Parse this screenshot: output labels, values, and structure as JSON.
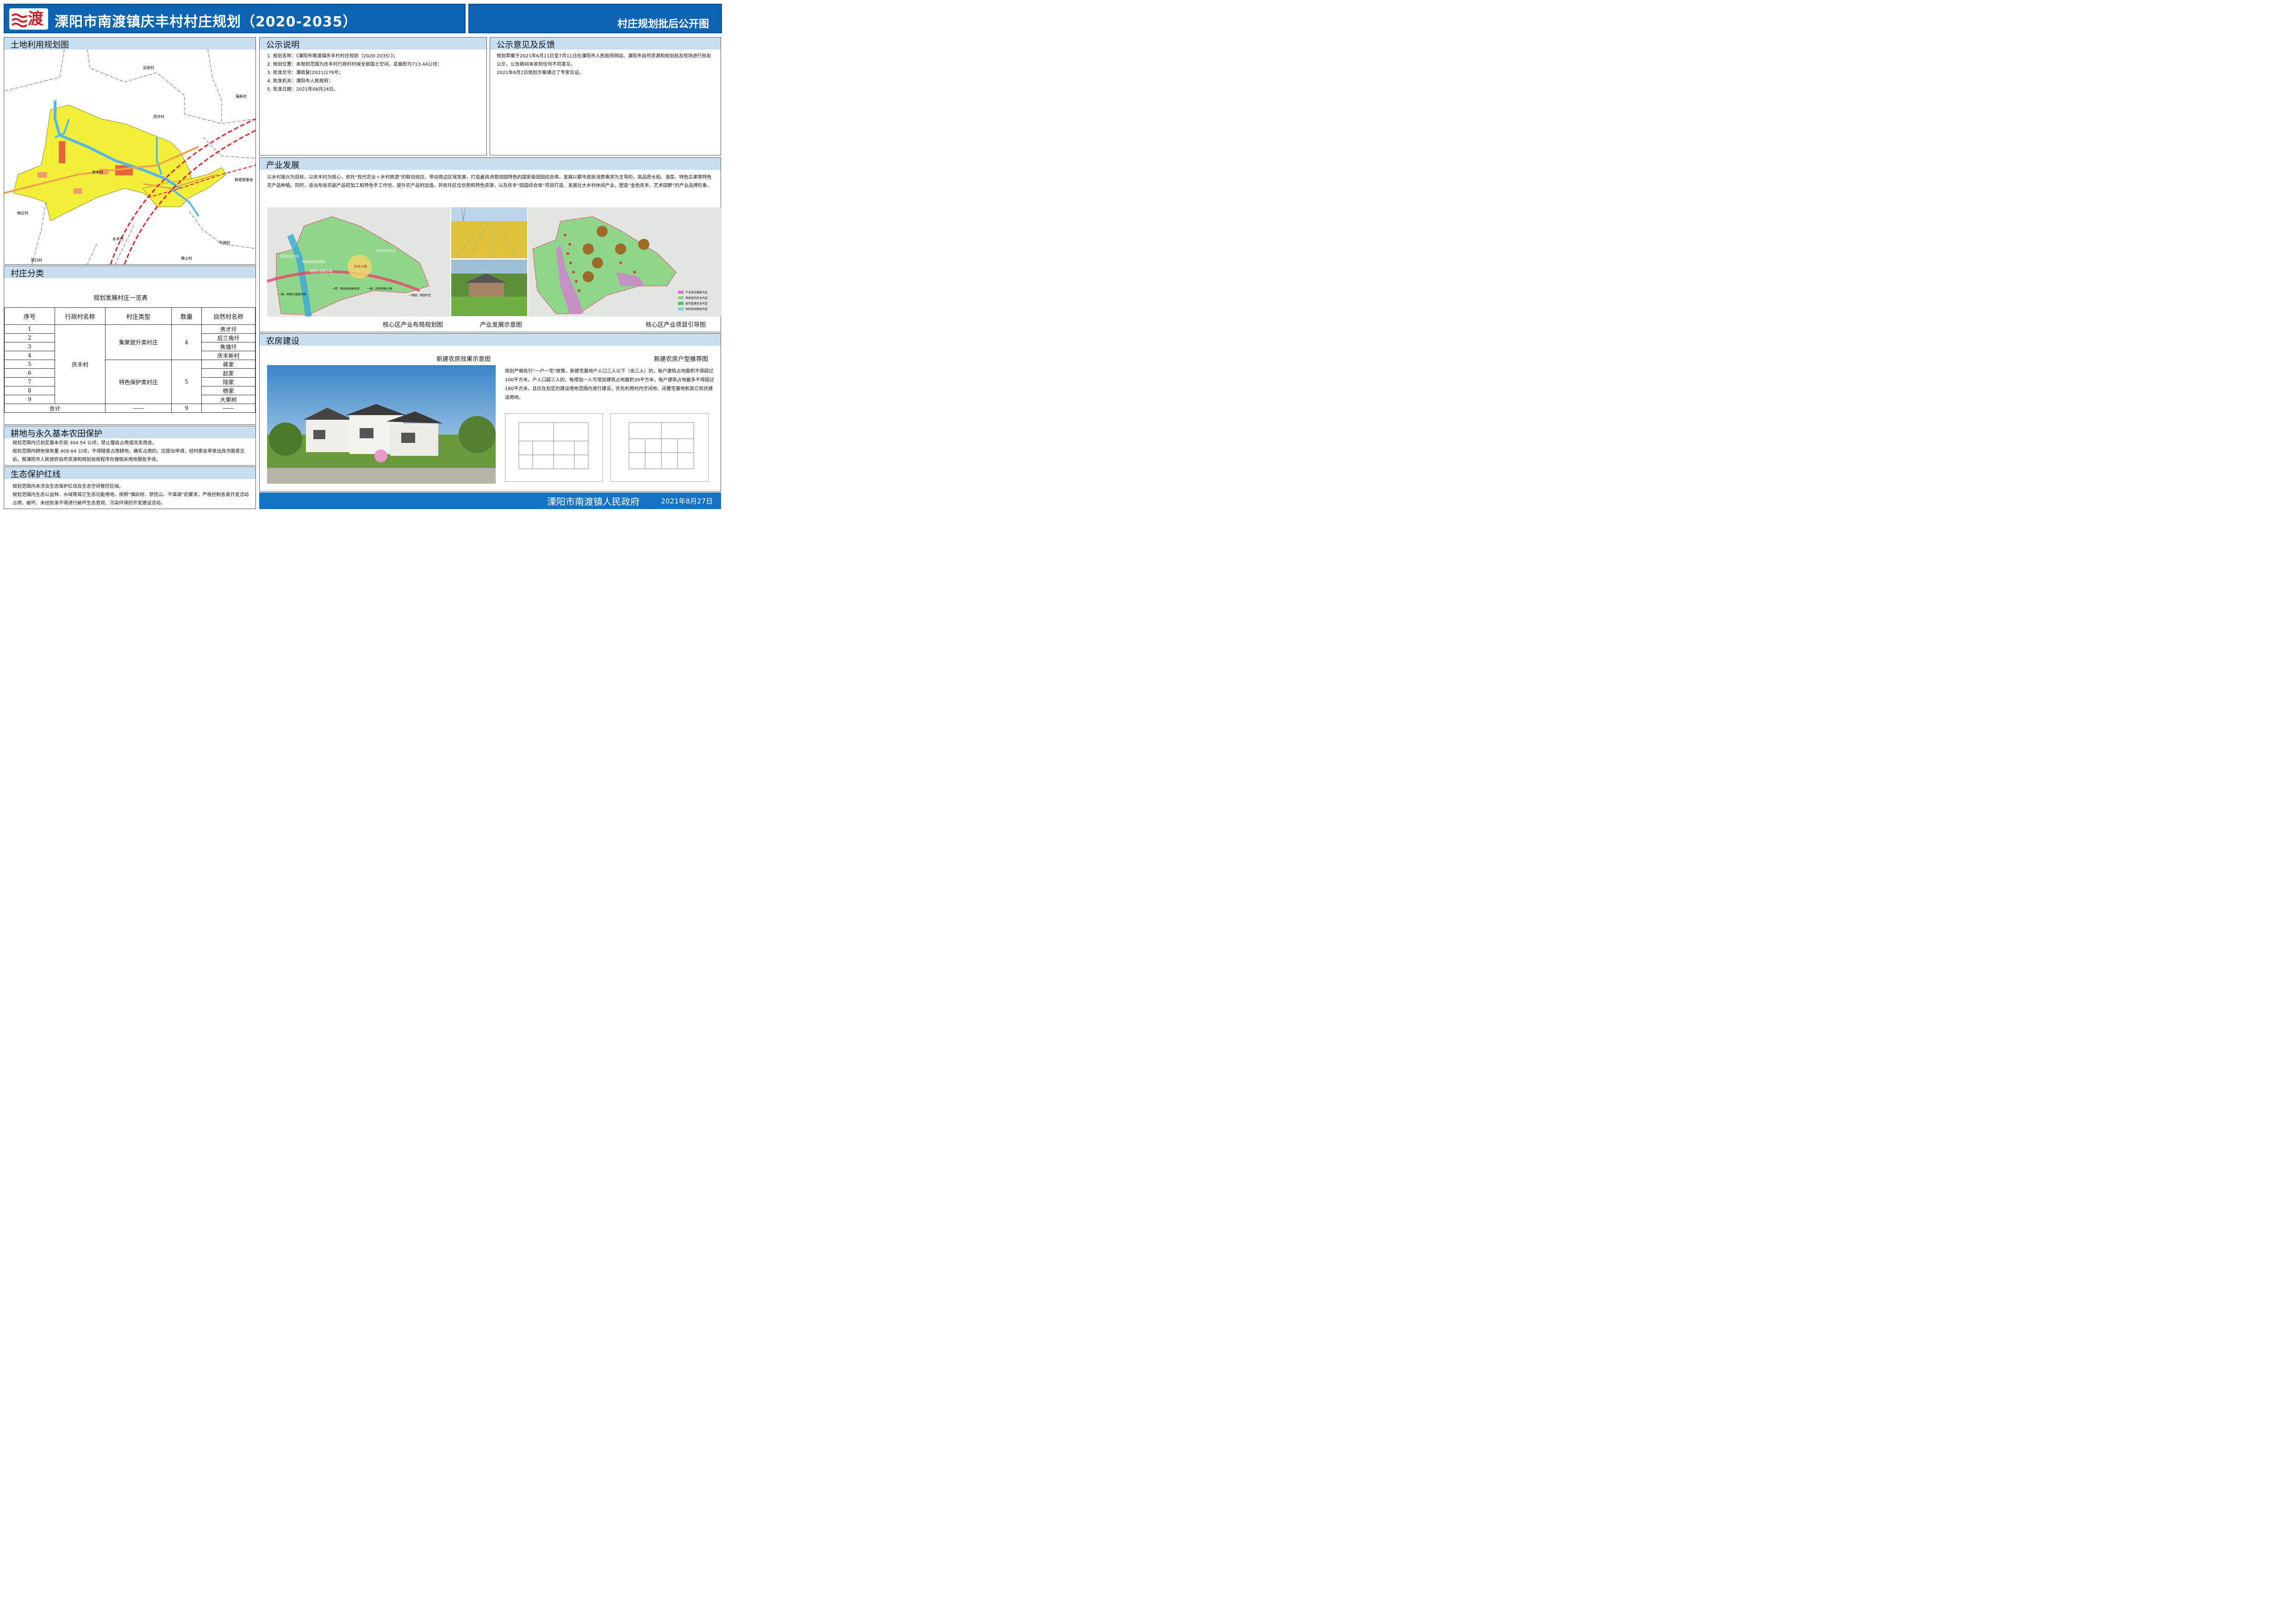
{
  "header": {
    "title": "溧阳市南渡镇庆丰村村庄规划（2020-2035）",
    "subtitle": "村庄规划批后公开图",
    "logo_glyph": "渡"
  },
  "land_use": {
    "title": "土地利用规划图",
    "map_labels": {
      "jiuyi": "旧邑村",
      "fuxin": "福新村",
      "xiyu": "西圩村",
      "qingfeng": "庆丰村",
      "lianwang": "联望居委会",
      "meizhuang": "梅庄村",
      "yongfeng": "永丰村",
      "pingcheng": "平城村",
      "zhoukou": "塑口村",
      "huangshan": "黄山村"
    }
  },
  "village_class": {
    "title": "村庄分类",
    "table_title": "规划发展村庄一览表",
    "headers": [
      "序号",
      "行政村名称",
      "村庄类型",
      "数量",
      "自然村名称"
    ],
    "admin_village": "庆丰村",
    "groups": [
      {
        "type": "集聚提升类村庄",
        "count": "4"
      },
      {
        "type": "特色保护类村庄",
        "count": "5"
      }
    ],
    "rows": [
      {
        "no": "1",
        "name": "秀才圩"
      },
      {
        "no": "2",
        "name": "后三角圩"
      },
      {
        "no": "3",
        "name": "焦塘圩"
      },
      {
        "no": "4",
        "name": "庆丰新村"
      },
      {
        "no": "5",
        "name": "蒋家"
      },
      {
        "no": "6",
        "name": "赵家"
      },
      {
        "no": "7",
        "name": "陆家"
      },
      {
        "no": "8",
        "name": "杨家"
      },
      {
        "no": "9",
        "name": "大栗树"
      }
    ],
    "total_label": "合计",
    "total_dash": "——",
    "total_count": "9"
  },
  "farmland": {
    "title": "耕地与永久基本农田保护",
    "p1": "规划范围内已划定基本农田 304.54 公顷，禁止擅自占用或改变用途。",
    "p2": "规划范围内耕地保有量 409.64 公顷，不得随意占用耕地，确实占用的，应提出申请，经村委会审查出具书面意见后，报溧阳市人民政府自然资源和规划局按程序办理相关用地报批手续。"
  },
  "eco": {
    "title": "生态保护红线",
    "p1": "规划范围内未涉及生态保护红线及生态空间管控区域。",
    "p2": "规划范围内生态公益林、水域等其它生态功能用地，按照“慎砍树、禁挖山、不填湖”的要求，严格控制各类开发活动占用、破坏，未经批准不得进行破坏生态景观、污染环境的开发建设活动。"
  },
  "notice": {
    "title": "公示说明",
    "items": [
      "1. 规划名称：《溧阳市南渡镇庆丰村村庄规划（2020-2035）》；",
      "2. 规划位置：本规划范围为庆丰村行政村村域全部国土空间，总面积为713.44公顷；",
      "3. 批准文号：溧政复[2021]176号；",
      "4. 批准机关：溧阳市人民政府；",
      "5. 批准日期：2021年08月24日。"
    ]
  },
  "feedback": {
    "title": "公示意见及反馈",
    "p1": "规划草案于2021年6月11日至7月11日在溧阳市人民政府网站、溧阳市自然资源和规划局及现场进行批前公示，公告期间未收到任何不同意见。",
    "p2": "2021年6月2日规划方案通过了专家论证。"
  },
  "industry": {
    "title": "产业发展",
    "text": "以乡村振兴为目标，以庆丰村为核心，依托“现代农业＋乡村旅游”的联动效应，带动周边区域发展，打造最具诗意田园特色的国家级田园综合体。发展以都市居民消费需求为主导的，高品质水稻、油菜、特色瓜果等特色农产品种植。同时，适当布局农副产品初加工和特色手工作坊，提升农产品附加值。并依托区位优势和特色资源，以及庆丰“田园综合体”项目打造，发展壮大乡村休闲产业，塑造“金色庆丰、艺术田野”的产业品牌形象。",
    "captions": [
      "核心区产业布局规划图",
      "产业发展示意图",
      "核心区产业项目引导图"
    ],
    "map1_labels": {
      "tech_zone": "科技农业片区",
      "leisure": "特色休闲体验带",
      "forest": "林荫大道展示轴",
      "modern": "现代农业片区",
      "town": "庆丰小镇",
      "axis1": "一轴：林荫大道展示轴",
      "band1": "一带：特色休闲体验带",
      "town1": "一镇：庆丰特色小镇",
      "field1": "一田园：田园片区"
    },
    "map2_legend": [
      "产业综合服务片区",
      "科技现代农业片区",
      "现代智慧农业片区",
      "村民休闲体验片区"
    ]
  },
  "housing": {
    "title": "农房建设",
    "effect_caption": "新建农房效果示意图",
    "plan_caption": "新建农房户型推荐图",
    "text": "规划严格执行“一户一宅”政策，新建宅基地户人口三人以下（含三人）的，每户建筑占地面积不得超过100平方米，户人口超三人的，每增加一人可增加建筑占地面积30平方米，每户建筑占地最多不得超过180平方米，且应在划定的建设用地范围内进行建设，优先利用村内空闲地、闲置宅基地和其它现状建设用地。"
  },
  "footer": {
    "org": "溧阳市南渡镇人民政府",
    "date": "2021年8月27日"
  },
  "colors": {
    "header_blue": "#0d64b2",
    "section_header": "#c8dff2",
    "village_yellow": "#f2ef3a",
    "rail_red": "#e0262b",
    "industry_green": "#8fd68a"
  }
}
